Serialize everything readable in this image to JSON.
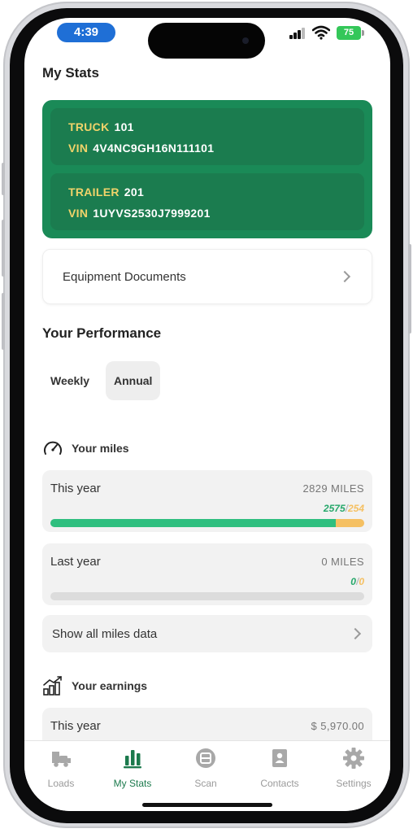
{
  "status_bar": {
    "time": "4:39",
    "battery": "75"
  },
  "page_title": "My Stats",
  "equipment": [
    {
      "type_label": "TRUCK",
      "number": "101",
      "vin_label": "VIN",
      "vin": "4V4NC9GH16N111101"
    },
    {
      "type_label": "TRAILER",
      "number": "201",
      "vin_label": "VIN",
      "vin": "1UYVS2530J7999201"
    }
  ],
  "equipment_documents_label": "Equipment Documents",
  "performance": {
    "title": "Your Performance",
    "tabs": [
      {
        "label": "Weekly",
        "active": false
      },
      {
        "label": "Annual",
        "active": true
      }
    ]
  },
  "miles": {
    "heading": "Your miles",
    "this_year": {
      "label": "This year",
      "value": "2829 MILES",
      "split_a": "2575",
      "split_b": "254",
      "progress_a": 0.91,
      "progress_b": 0.09
    },
    "last_year": {
      "label": "Last year",
      "value": "0 MILES",
      "split_a": "0",
      "split_b": "0",
      "progress_a": 0,
      "progress_b": 0
    },
    "show_all_label": "Show all miles data"
  },
  "earnings": {
    "heading": "Your earnings",
    "this_year": {
      "label": "This year",
      "value": "$ 5,970.00"
    }
  },
  "tabbar": [
    {
      "label": "Loads",
      "icon": "truck-icon",
      "active": false
    },
    {
      "label": "My Stats",
      "icon": "bar-chart-icon",
      "active": true
    },
    {
      "label": "Scan",
      "icon": "scan-icon",
      "active": false
    },
    {
      "label": "Contacts",
      "icon": "contact-book-icon",
      "active": false
    },
    {
      "label": "Settings",
      "icon": "gear-icon",
      "active": false
    }
  ],
  "colors": {
    "brand_green": "#1a8a57",
    "progress_green": "#2fbf7f",
    "progress_orange": "#f5c062",
    "vin_key_yellow": "#f1d36a"
  }
}
